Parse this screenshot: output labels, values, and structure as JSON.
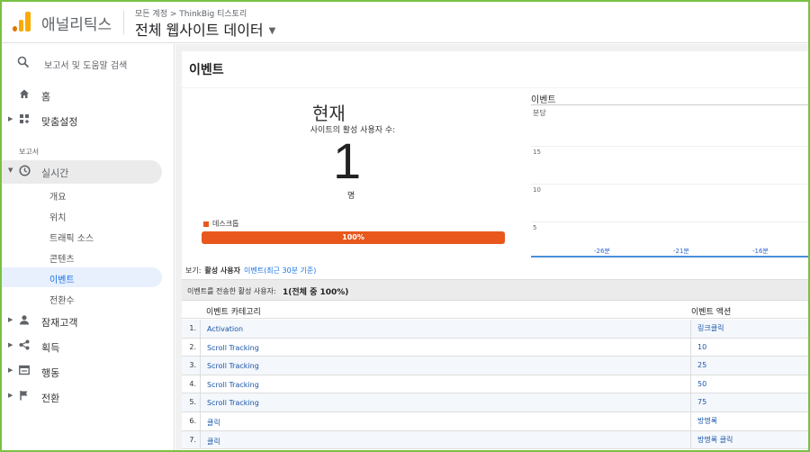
{
  "header": {
    "app_name": "애널리틱스",
    "account_crumb": "모든 계정 > ThinkBig 티스토리",
    "property_name": "전체 웹사이트 데이터"
  },
  "sidebar": {
    "search_label": "보고서 및 도움말 검색",
    "home": "홈",
    "customization": "맞춤설정",
    "reports_section": "보고서",
    "realtime": "실시간",
    "realtime_items": [
      "개요",
      "위치",
      "트래픽 소스",
      "콘텐츠",
      "이벤트",
      "전환수"
    ],
    "audience": "잠재고객",
    "acquisition": "획득",
    "behavior": "행동",
    "conversions": "전환"
  },
  "main": {
    "page_title": "이벤트",
    "now_label": "현재",
    "active_users_label": "사이트의 활성 사용자 수:",
    "active_users_count": "1",
    "unit_label": "명",
    "device_legend": "데스크톱",
    "device_percent": "100%",
    "device_share": 1.0,
    "view_prefix": "보기:",
    "view_active": "활성 사용자",
    "view_link": "이벤트(최근 30분 기준)",
    "summary_label": "이벤트를 전송한 활성 사용자:",
    "summary_value": "1(전체 중 100%)"
  },
  "chart_data": {
    "type": "line",
    "title": "이벤트",
    "ylabel": "분당",
    "yticks": [
      15,
      10,
      5
    ],
    "xticks": [
      "-26분",
      "-21분",
      "-16분"
    ],
    "grid": true
  },
  "table": {
    "headers": [
      "이벤트 카테고리",
      "이벤트 액션"
    ],
    "rows": [
      {
        "num": "1.",
        "category": "Activation",
        "action": "링크클릭"
      },
      {
        "num": "2.",
        "category": "Scroll Tracking",
        "action": "10"
      },
      {
        "num": "3.",
        "category": "Scroll Tracking",
        "action": "25"
      },
      {
        "num": "4.",
        "category": "Scroll Tracking",
        "action": "50"
      },
      {
        "num": "5.",
        "category": "Scroll Tracking",
        "action": "75"
      },
      {
        "num": "6.",
        "category": "클릭",
        "action": "방명록"
      },
      {
        "num": "7.",
        "category": "클릭",
        "action": "방명록 클릭"
      }
    ]
  },
  "colors": {
    "accent": "#1a73e8",
    "device_bar": "#e8581c",
    "highlight": "#e53935",
    "frame": "#7ac143"
  }
}
